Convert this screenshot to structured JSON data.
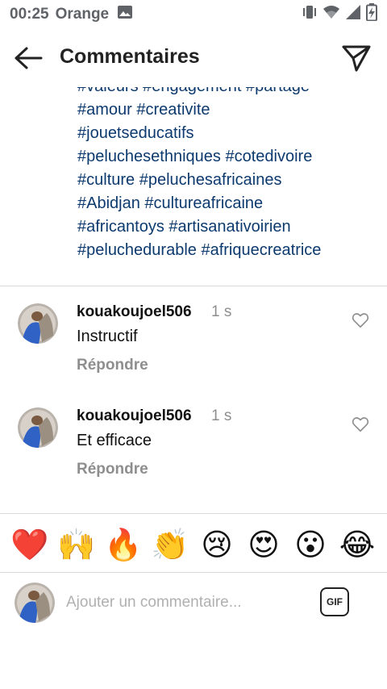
{
  "status_bar": {
    "time": "00:25",
    "carrier": "Orange",
    "icons": [
      "image-icon",
      "vibrate-icon",
      "wifi-icon",
      "signal-icon",
      "battery-icon"
    ]
  },
  "header": {
    "title": "Commentaires",
    "back_icon": "arrow-left-icon",
    "share_icon": "send-icon"
  },
  "caption": {
    "hashtag_lines": [
      "#valeurs #engagement #partage",
      "#amour #creativite",
      "#jouetseducatifs",
      "#peluchesethniques #cotedivoire",
      "#culture #peluchesafricaines",
      "#Abidjan #cultureafricaine",
      "#africantoys #artisanativoirien",
      "#peluchedurable #afriquecreatrice"
    ],
    "link_color": "#0d3a6e"
  },
  "comments": [
    {
      "username": "kouakoujoel506",
      "time": "1 s",
      "text": "Instructif",
      "reply_label": "Répondre"
    },
    {
      "username": "kouakoujoel506",
      "time": "1 s",
      "text": "Et efficace",
      "reply_label": "Répondre"
    }
  ],
  "quick_reactions": [
    "❤️",
    "🙌",
    "🔥",
    "👏",
    "😢",
    "😍",
    "😮",
    "😂"
  ],
  "composer": {
    "placeholder": "Ajouter un commentaire...",
    "gif_label": "GIF"
  }
}
